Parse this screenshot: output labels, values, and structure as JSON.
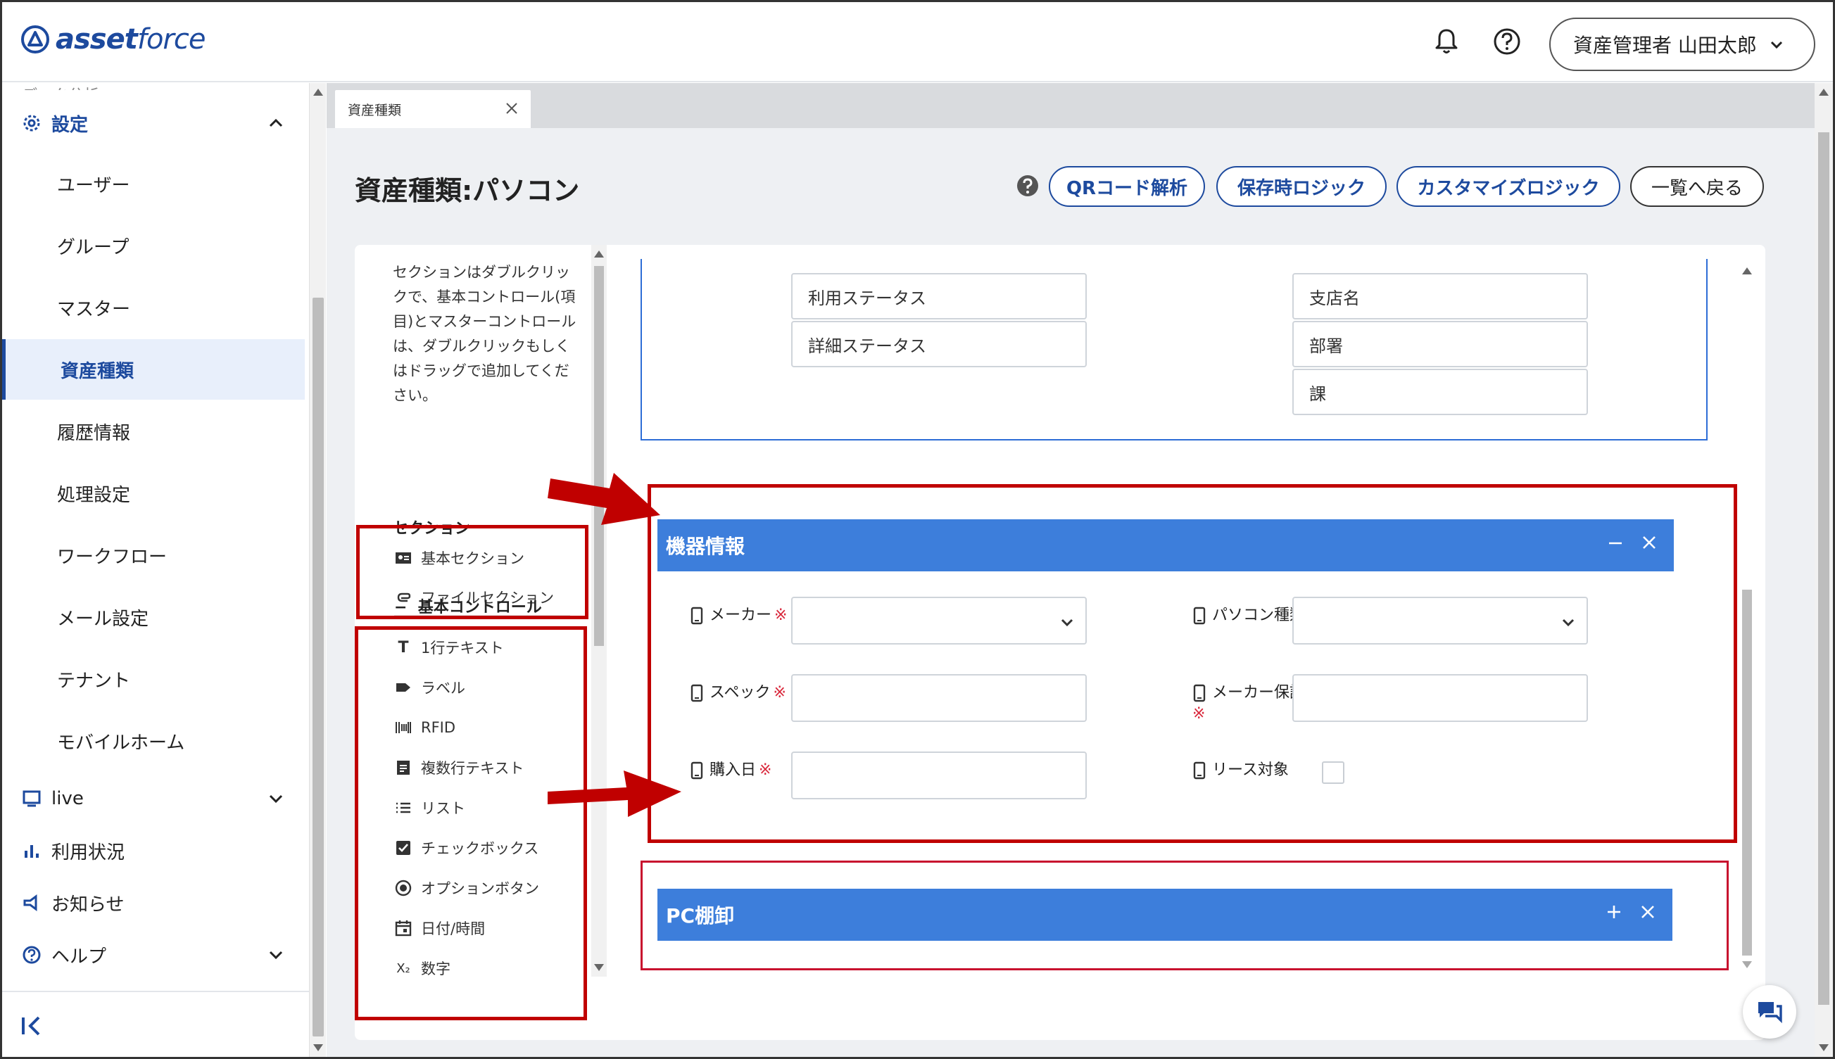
{
  "app": {
    "logo_bold": "asset",
    "logo_rest": "force"
  },
  "header": {
    "user_label": "資産管理者 山田太郎"
  },
  "sidebar": {
    "cut_text": "データ分析",
    "settings": "設定",
    "items": [
      "ユーザー",
      "グループ",
      "マスター",
      "資産種類",
      "履歴情報",
      "処理設定",
      "ワークフロー",
      "メール設定",
      "テナント",
      "モバイルホーム"
    ],
    "live": "live",
    "usage": "利用状況",
    "notice": "お知らせ",
    "help": "ヘルプ"
  },
  "tab": {
    "label": "資産種類"
  },
  "page": {
    "title": "資産種類:パソコン",
    "buttons": {
      "qr": "QRコード解析",
      "save_logic": "保存時ロジック",
      "custom_logic": "カスタマイズロジック",
      "back": "一覧へ戻る"
    }
  },
  "palette": {
    "help_text": "セクションはダブルクリックで、基本コントロール(項目)とマスターコントロールは、ダブルクリックもしくはドラッグで追加してください。",
    "section_title": "セクション",
    "sections": [
      "基本セクション",
      "ファイルセクション"
    ],
    "basic_controls_title": "基本コントロール",
    "controls": [
      "1行テキスト",
      "ラベル",
      "RFID",
      "複数行テキスト",
      "リスト",
      "チェックボックス",
      "オプションボタン",
      "日付/時間",
      "数字"
    ]
  },
  "canvas": {
    "top_fields_left": [
      "利用ステータス",
      "詳細ステータス"
    ],
    "top_fields_right": [
      "支店名",
      "部署",
      "課"
    ],
    "section_device": {
      "title": "機器情報",
      "fields": [
        {
          "label": "メーカー",
          "required_mark": "※"
        },
        {
          "label": "パソコン種類",
          "required_mark": "※"
        },
        {
          "label": "スペック",
          "required_mark": "※"
        },
        {
          "label": "メーカー保証期間",
          "required_mark": "※"
        },
        {
          "label": "購入日",
          "required_mark": "※"
        },
        {
          "label": "リース対象",
          "required_mark": ""
        }
      ]
    },
    "section_pc": {
      "title": "PC棚卸"
    }
  },
  "colors": {
    "brand": "#1d4a9e",
    "section_bar": "#3d7edb",
    "highlight": "#c00000",
    "required": "#d9283c"
  }
}
